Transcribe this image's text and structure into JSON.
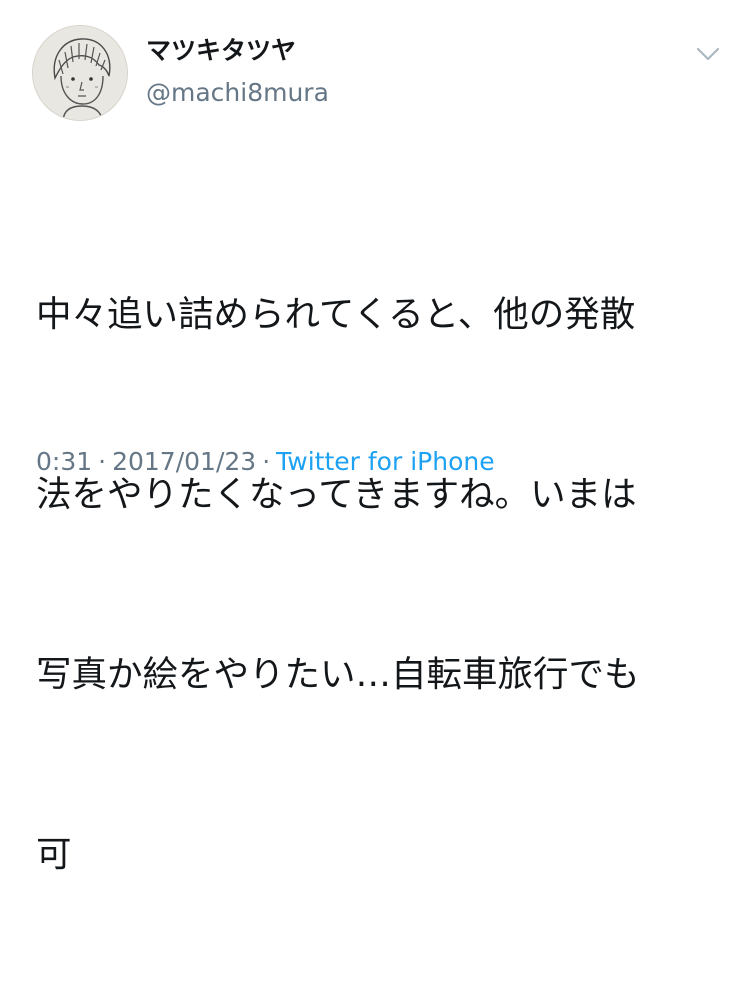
{
  "user": {
    "display_name": "マツキタツヤ",
    "username": "@machi8mura",
    "avatar_icon": "user-sketch-avatar-icon"
  },
  "tweet": {
    "lines": [
      "中々追い詰められてくると、他の発散",
      "法をやりたくなってきますね。いまは",
      "写真か絵をやりたい…自転車旅行でも",
      "可"
    ],
    "time": "0:31",
    "separator": "·",
    "date": "2017/01/23",
    "source": "Twitter for iPhone"
  },
  "menu": {
    "icon": "chevron-down-icon"
  },
  "colors": {
    "text": "#14171a",
    "secondary": "#657786",
    "link": "#1da1f2"
  }
}
